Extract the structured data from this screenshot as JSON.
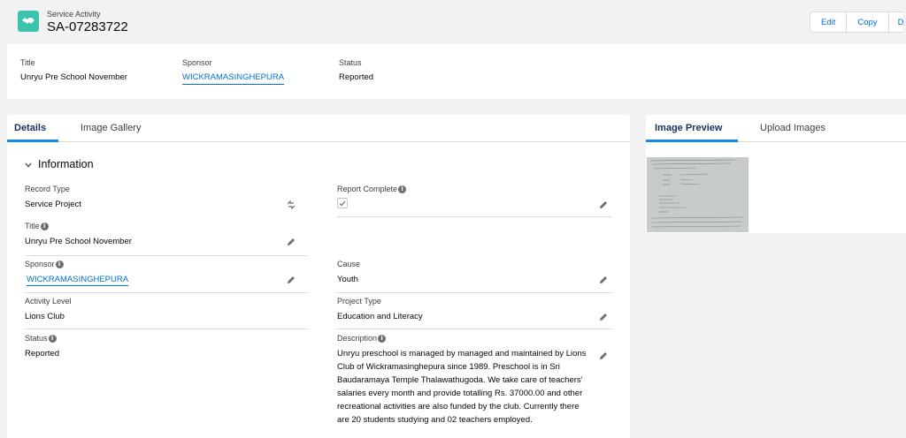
{
  "header": {
    "object_type": "Service Activity",
    "record_name": "SA-07283722",
    "buttons": [
      "Edit",
      "Copy",
      "D"
    ]
  },
  "highlights": [
    {
      "label": "Title",
      "value": "Unryu Pre School November"
    },
    {
      "label": "Sponsor",
      "value": "WICKRAMASINGHEPURA"
    },
    {
      "label": "Status",
      "value": "Reported"
    }
  ],
  "main_tabs": [
    "Details",
    "Image Gallery"
  ],
  "section": {
    "title": "Information"
  },
  "fields": {
    "record_type": {
      "label": "Record Type",
      "value": "Service Project"
    },
    "report_complete": {
      "label": "Report Complete",
      "checked": true
    },
    "title": {
      "label": "Title",
      "value": "Unryu Pre School November"
    },
    "sponsor": {
      "label": "Sponsor",
      "value": "WICKRAMASINGHEPURA"
    },
    "cause": {
      "label": "Cause",
      "value": "Youth"
    },
    "activity_level": {
      "label": "Activity Level",
      "value": "Lions Club"
    },
    "project_type": {
      "label": "Project Type",
      "value": "Education and Literacy"
    },
    "status": {
      "label": "Status",
      "value": "Reported"
    },
    "description": {
      "label": "Description",
      "value": "Unryu preschool is managed by managed and maintained by Lions Club of Wickramasinghepura since 1989. Preschool is in Sri Baudaramaya Temple Thalawathugoda. We take care of teachers' salaries every month and provide totalling Rs. 37000.00 and other recreational activities are also funded by the club. Currently there are 20 students studying and 02 teachers employed."
    }
  },
  "side_tabs": [
    "Image Preview",
    "Upload Images"
  ],
  "icons": {
    "record_icon": "handshake-icon",
    "info": "info-icon",
    "edit": "pencil-icon",
    "chevron": "chevron-down-icon",
    "record_type_change": "change-record-type-icon"
  },
  "colors": {
    "brand": "#0070d2",
    "record_icon_bg": "#3bc4a9",
    "tab_active_underline": "#1589ee"
  }
}
